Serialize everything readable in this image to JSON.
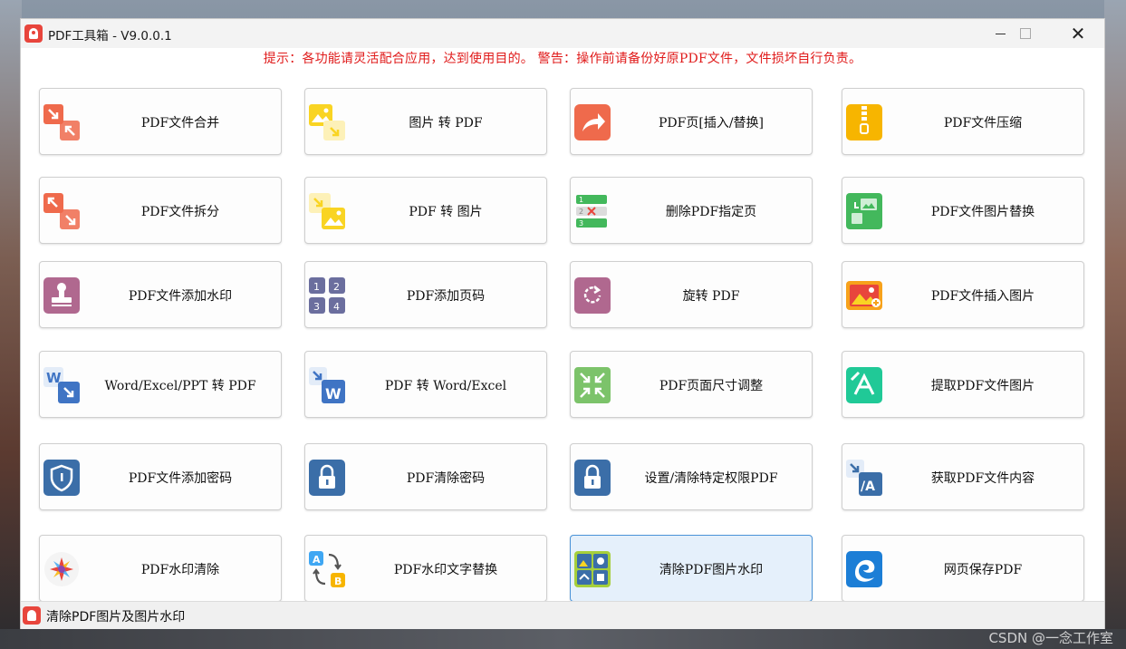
{
  "window": {
    "title": "PDF工具箱 - V9.0.0.1",
    "minimize": "minimize",
    "maximize": "maximize",
    "close": "✕"
  },
  "notice": "提示：各功能请灵活配合应用，达到使用目的。 警告：操作前请备份好原PDF文件，文件损坏自行负责。",
  "tiles": [
    {
      "label": "PDF文件合并",
      "icon": "merge-arrows-icon",
      "color": "#ef6a4c"
    },
    {
      "label": "图片 转 PDF",
      "icon": "image-to-pdf-icon",
      "color": "#f9d423"
    },
    {
      "label": "PDF页[插入/替换]",
      "icon": "share-arrow-icon",
      "color": "#ef6a4c"
    },
    {
      "label": "PDF文件压缩",
      "icon": "zip-icon",
      "color": "#f7b500"
    },
    {
      "label": "PDF文件拆分",
      "icon": "split-arrows-icon",
      "color": "#ef6a4c"
    },
    {
      "label": "PDF 转 图片",
      "icon": "pdf-to-image-icon",
      "color": "#f9d423"
    },
    {
      "label": "删除PDF指定页",
      "icon": "delete-page-icon",
      "color": "#43b85c"
    },
    {
      "label": "PDF文件图片替换",
      "icon": "replace-image-icon",
      "color": "#43b85c"
    },
    {
      "label": "PDF文件添加水印",
      "icon": "stamp-icon",
      "color": "#b0688f"
    },
    {
      "label": "PDF添加页码",
      "icon": "page-number-icon",
      "color": "#6b6e9e"
    },
    {
      "label": "旋转 PDF",
      "icon": "rotate-icon",
      "color": "#b0688f"
    },
    {
      "label": "PDF文件插入图片",
      "icon": "insert-image-icon",
      "color": "#f7a21b"
    },
    {
      "label": "Word/Excel/PPT 转 PDF",
      "icon": "word-to-pdf-icon",
      "color": "#3f74c4"
    },
    {
      "label": "PDF 转 Word/Excel",
      "icon": "pdf-to-word-icon",
      "color": "#3f74c4"
    },
    {
      "label": "PDF页面尺寸调整",
      "icon": "resize-icon",
      "color": "#7cc36a"
    },
    {
      "label": "提取PDF文件图片",
      "icon": "extract-image-icon",
      "color": "#20c997"
    },
    {
      "label": "PDF文件添加密码",
      "icon": "shield-icon",
      "color": "#3b6ea8"
    },
    {
      "label": "PDF清除密码",
      "icon": "lock-icon",
      "color": "#3b6ea8"
    },
    {
      "label": "设置/清除特定权限PDF",
      "icon": "permission-lock-icon",
      "color": "#3b6ea8"
    },
    {
      "label": "获取PDF文件内容",
      "icon": "get-content-icon",
      "color": "#3b6ea8"
    },
    {
      "label": "PDF水印清除",
      "icon": "starburst-icon",
      "color": "#8e44ad"
    },
    {
      "label": "PDF水印文字替换",
      "icon": "text-swap-icon",
      "color": "#f7b500"
    },
    {
      "label": "清除PDF图片水印",
      "icon": "clear-image-watermark-icon",
      "color": "#a6cf3b"
    },
    {
      "label": "网页保存PDF",
      "icon": "edge-browser-icon",
      "color": "#1c7ed6"
    }
  ],
  "status": "清除PDF图片及图片水印",
  "watermark": "CSDN @一念工作室"
}
